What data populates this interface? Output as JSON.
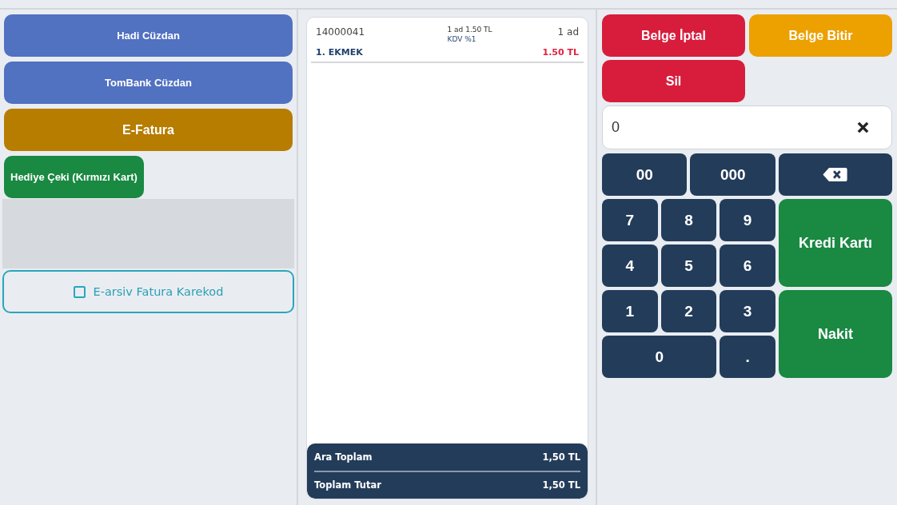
{
  "left_panel": {
    "buttons": [
      {
        "label": "Hadi Cüzdan",
        "kind": "wallet"
      },
      {
        "label": "TomBank Cüzdan",
        "kind": "wallet"
      },
      {
        "label": "E-Fatura",
        "kind": "invoice"
      },
      {
        "label": "Hediye Çeki (Kırmızı Kart)",
        "kind": "voucher"
      }
    ],
    "qr_option": {
      "label": "E-arsiv Fatura Karekod",
      "checked": false
    }
  },
  "receipt": {
    "items": [
      {
        "barcode": "14000041",
        "unit_price": "1 ad 1.50 TL",
        "tax": "KDV %1",
        "quantity": "1 ad",
        "name": "1. EKMEK",
        "amount": "1.50 TL"
      }
    ],
    "totals": [
      {
        "label": "Ara Toplam",
        "value": "1,50 TL"
      },
      {
        "label": "Toplam Tutar",
        "value": "1,50 TL"
      }
    ]
  },
  "right_panel": {
    "actions": [
      {
        "label": "Belge İptal",
        "kind": "danger"
      },
      {
        "label": "Belge Bitir",
        "kind": "warning"
      },
      {
        "label": "Sil",
        "kind": "danger"
      }
    ],
    "amount_field": {
      "value": "0"
    },
    "keypad": [
      {
        "label": "00",
        "kind": "key"
      },
      {
        "label": "000",
        "kind": "key"
      },
      {
        "kind": "backspace"
      },
      {
        "label": "7",
        "kind": "key"
      },
      {
        "label": "8",
        "kind": "key"
      },
      {
        "label": "9",
        "kind": "key"
      },
      {
        "label": "Kredi Kartı",
        "kind": "payment"
      },
      {
        "label": "4",
        "kind": "key"
      },
      {
        "label": "5",
        "kind": "key"
      },
      {
        "label": "6",
        "kind": "key"
      },
      {
        "label": "1",
        "kind": "key"
      },
      {
        "label": "2",
        "kind": "key"
      },
      {
        "label": "3",
        "kind": "key"
      },
      {
        "label": "Nakit",
        "kind": "payment"
      },
      {
        "label": "0",
        "kind": "key"
      },
      {
        "label": ".",
        "kind": "key"
      }
    ]
  }
}
